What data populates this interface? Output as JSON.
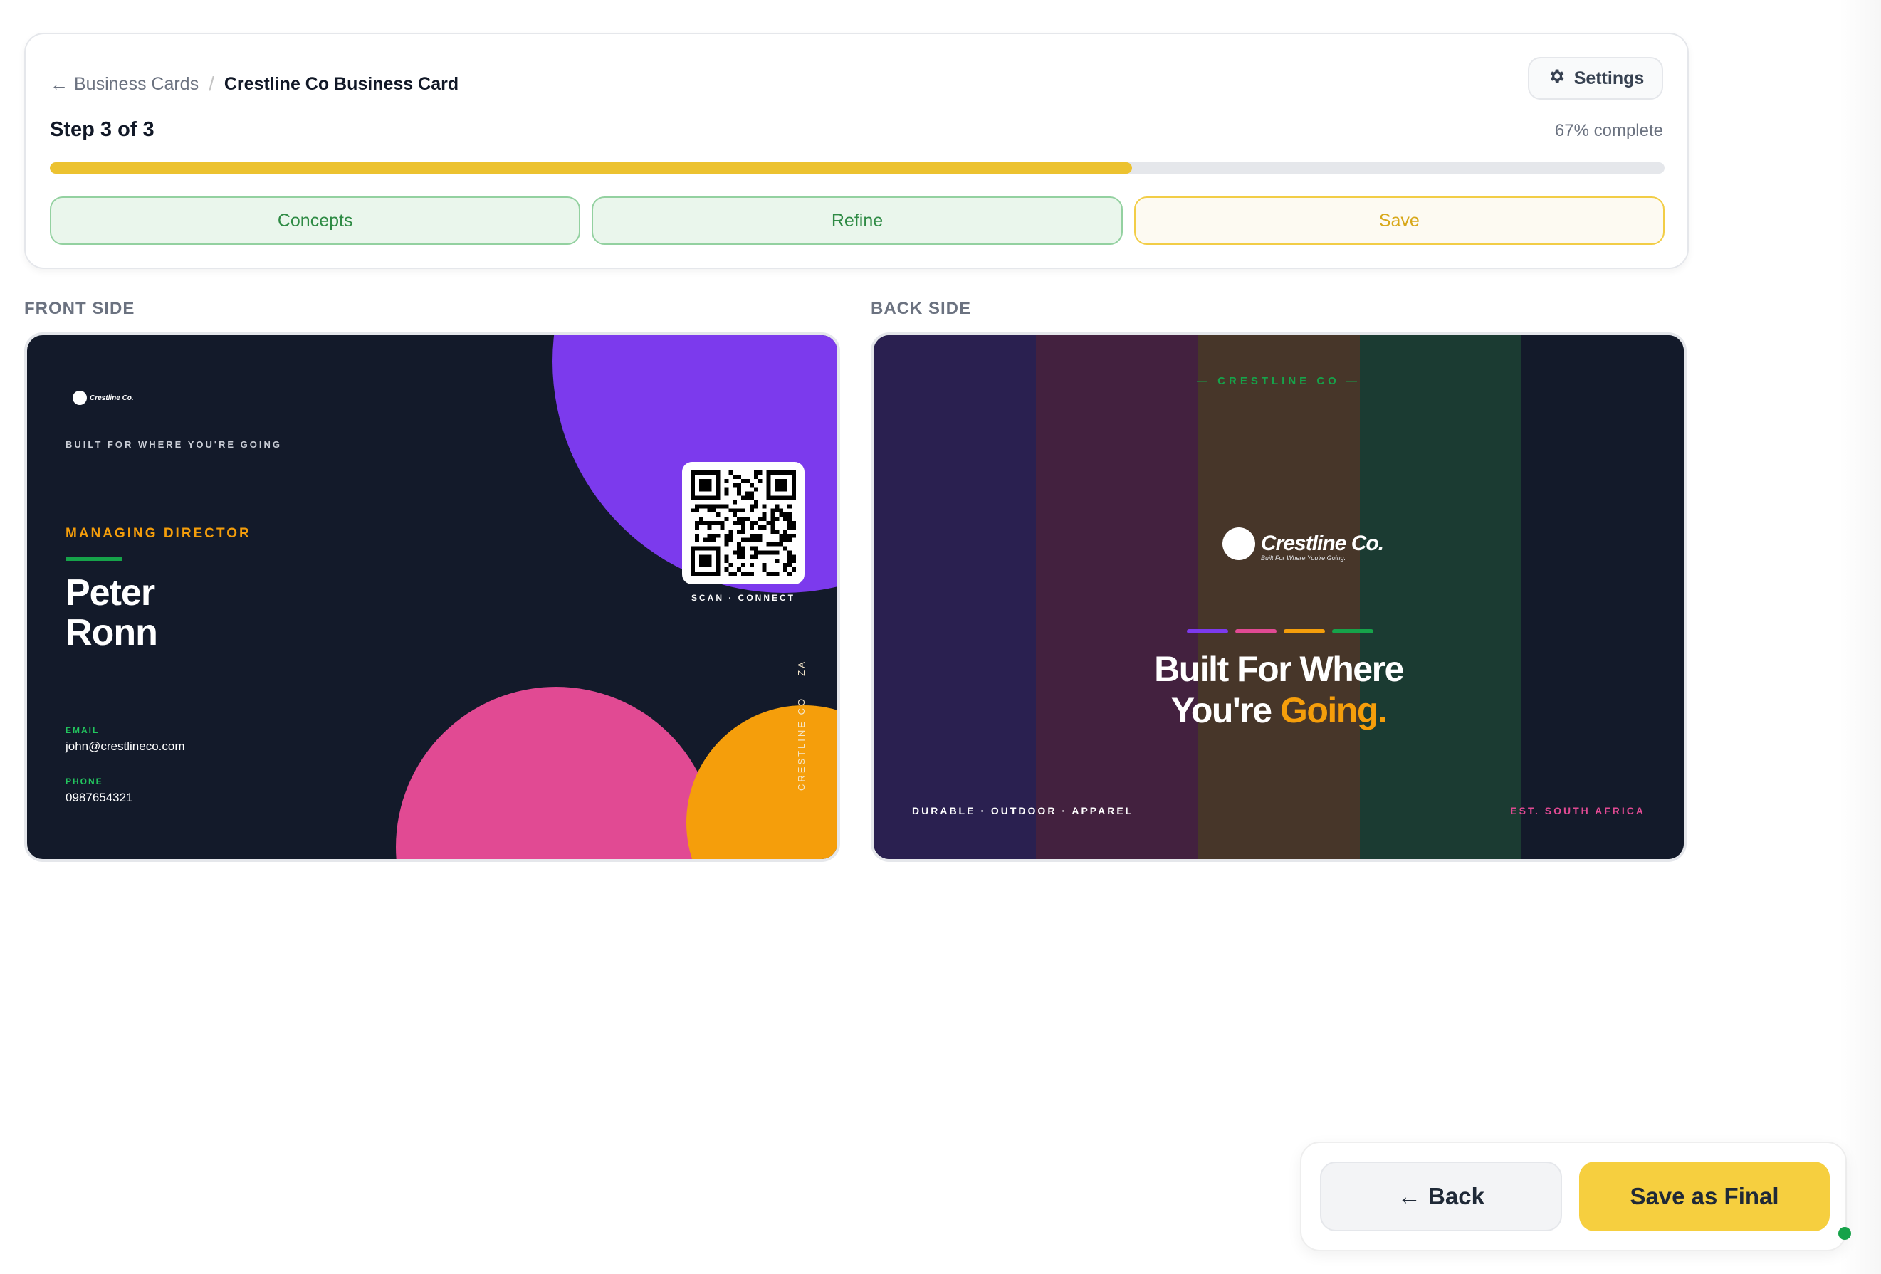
{
  "breadcrumb": {
    "parent_label": "Business Cards",
    "separator": "/",
    "current_label": "Crestline Co Business Card"
  },
  "settings_label": "Settings",
  "progress": {
    "step_label": "Step 3 of 3",
    "percent_label": "67% complete",
    "percent_value": 67
  },
  "tabs": [
    {
      "label": "Concepts",
      "state": "done"
    },
    {
      "label": "Refine",
      "state": "done"
    },
    {
      "label": "Save",
      "state": "active"
    }
  ],
  "sections": {
    "front": "FRONT SIDE",
    "back": "BACK SIDE"
  },
  "front_card": {
    "logo_text": "Crestline Co.",
    "tagline": "BUILT FOR WHERE YOU'RE GOING",
    "role": "MANAGING DIRECTOR",
    "name_first": "Peter",
    "name_last": "Ronn",
    "email_label": "EMAIL",
    "email": "john@crestlineco.com",
    "phone_label": "PHONE",
    "phone": "0987654321",
    "qr_caption": "SCAN · CONNECT",
    "vertical_text": "CRESTLINE CO — ZA"
  },
  "back_card": {
    "brand_top": "— CRESTLINE CO —",
    "logo_text": "Crestline Co.",
    "logo_subtext": "Built For Where You're Going.",
    "headline_line1": "Built For Where",
    "headline_line2_a": "You're ",
    "headline_line2_b": "Going.",
    "footer_left": "DURABLE · OUTDOOR · APPAREL",
    "footer_right": "EST. SOUTH AFRICA"
  },
  "colors": {
    "accent_yellow": "#ecc230",
    "card_bg": "#131a2a",
    "purple": "#7c3aed",
    "pink": "#e14a93",
    "orange": "#f59e0b",
    "green": "#16a34a",
    "stripes": [
      "#2a2050",
      "#43213f",
      "#473629",
      "#1b3b32",
      "#131a2a"
    ]
  },
  "actions": {
    "back_label": "Back",
    "save_final_label": "Save as Final"
  }
}
